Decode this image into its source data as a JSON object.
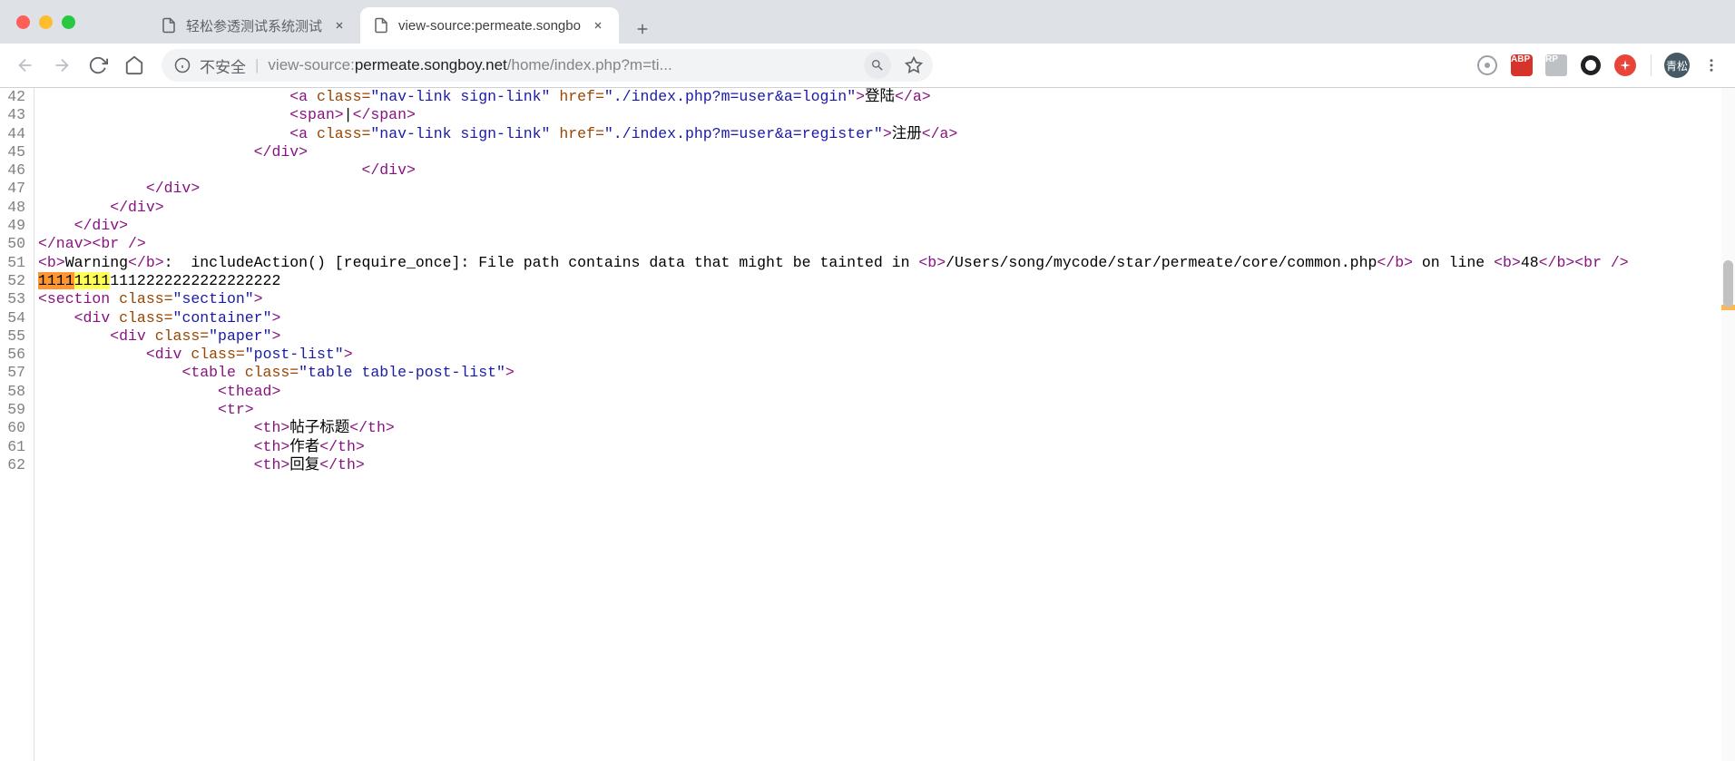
{
  "tabs": [
    {
      "title": "轻松参透测试系统测试",
      "active": false
    },
    {
      "title": "view-source:permeate.songbo",
      "active": true
    }
  ],
  "omnibox": {
    "security_label": "不安全",
    "url_prefix": "view-source:",
    "url_host": "permeate.songboy.net",
    "url_path": "/home/index.php?m=ti..."
  },
  "avatar_label": "青松",
  "line_numbers": [
    "42",
    "43",
    "44",
    "45",
    "46",
    "47",
    "48",
    "49",
    "50",
    "51",
    "",
    "52",
    "53",
    "54",
    "55",
    "56",
    "57",
    "58",
    "59",
    "60",
    "61",
    "62"
  ],
  "source": {
    "l42": {
      "indent": "                            ",
      "tag_open": "<a ",
      "attr1": "class=",
      "val1": "\"nav-link sign-link\"",
      "attr2": " href=",
      "val2": "\"./index.php?m=user&a=login\"",
      "close_gt": ">",
      "text": "登陆",
      "tag_close": "</a>"
    },
    "l43": {
      "indent": "                            ",
      "open": "<span>",
      "text": "|",
      "close": "</span>"
    },
    "l44": {
      "indent": "                            ",
      "tag_open": "<a ",
      "attr1": "class=",
      "val1": "\"nav-link sign-link\"",
      "attr2": " href=",
      "val2": "\"./index.php?m=user&a=register\"",
      "close_gt": ">",
      "text": "注册",
      "tag_close": "</a>"
    },
    "l45": {
      "indent": "                        ",
      "tag": "</div>"
    },
    "l46": {
      "indent": "                                    ",
      "tag": "</div>"
    },
    "l47": {
      "indent": "            ",
      "tag": "</div>"
    },
    "l48": {
      "indent": "        ",
      "tag": "</div>"
    },
    "l49": {
      "indent": "    ",
      "tag": "</div>"
    },
    "l50": {
      "nav": "</nav>",
      "br": "<br />"
    },
    "l51": {
      "b_open": "<b>",
      "warn": "Warning",
      "b_close": "</b>",
      "colon_msg": ":  includeAction() [require_once]: File path contains data that might be tainted in ",
      "b_open2": "<b>",
      "path": "/Users/song/mycode/star/permeate/core/common.php",
      "b_close2": "</b>",
      "online": " on line ",
      "b_open3": "<b>",
      "num": "48",
      "b_close3": "</b>",
      "br": "<br />"
    },
    "l52": {
      "hl1": "1111",
      "hl2": "1111",
      "rest": "1112222222222222222"
    },
    "l53": {
      "open": "<section ",
      "attr": "class=",
      "val": "\"section\"",
      "gt": ">"
    },
    "l54": {
      "indent": "    ",
      "open": "<div ",
      "attr": "class=",
      "val": "\"container\"",
      "gt": ">"
    },
    "l55": {
      "indent": "        ",
      "open": "<div ",
      "attr": "class=",
      "val": "\"paper\"",
      "gt": ">"
    },
    "l56": {
      "indent": "            ",
      "open": "<div ",
      "attr": "class=",
      "val": "\"post-list\"",
      "gt": ">"
    },
    "l57": {
      "indent": "                ",
      "open": "<table ",
      "attr": "class=",
      "val": "\"table table-post-list\"",
      "gt": ">"
    },
    "l58": {
      "indent": "                    ",
      "tag": "<thead>"
    },
    "l59": {
      "indent": "                    ",
      "tag": "<tr>"
    },
    "l60": {
      "indent": "                        ",
      "open": "<th>",
      "text": "帖子标题",
      "close": "</th>"
    },
    "l61": {
      "indent": "                        ",
      "open": "<th>",
      "text": "作者",
      "close": "</th>"
    },
    "l62": {
      "indent": "                        ",
      "open": "<th>",
      "text": "回复",
      "close": "</th>"
    }
  }
}
